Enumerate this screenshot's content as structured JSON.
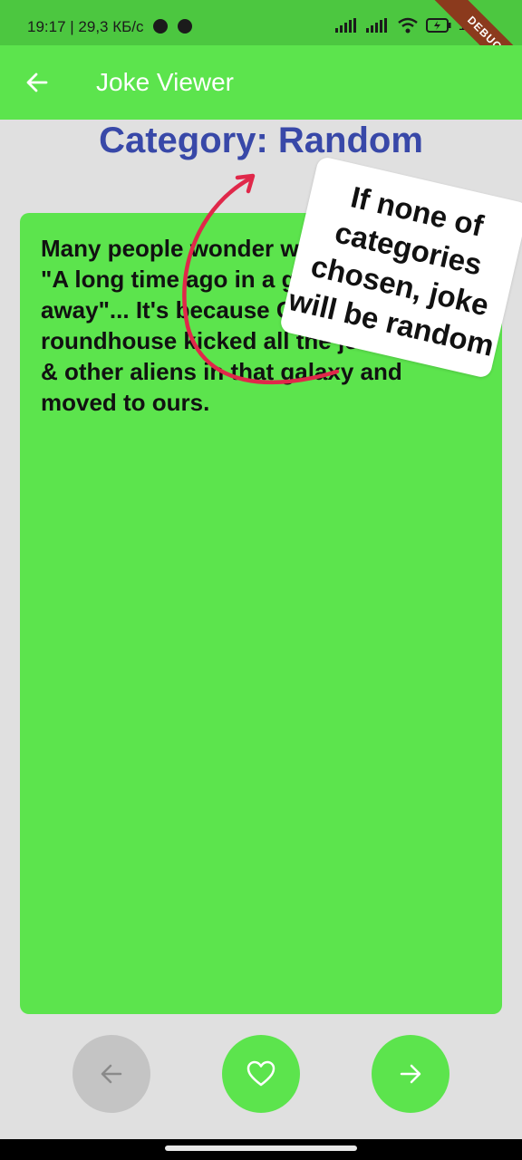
{
  "status_bar": {
    "time_speed": "19:17 | 29,3 КБ/с",
    "battery": "100"
  },
  "debug_banner": "DEBUG",
  "app_bar": {
    "title": "Joke Viewer",
    "back_icon": "arrow-back-icon"
  },
  "category": {
    "title": "Category: Random"
  },
  "joke": {
    "text": "Many people wonder why begins with \"A long time ago in a galaxy far, far away\"... It's because Chuck Norris roundhouse kicked all the jedi, clones & other aliens in that galaxy and moved to ours."
  },
  "annotation": {
    "note": "If none of categories chosen, joke will be random",
    "arrow_color": "#e0284a"
  },
  "buttons": {
    "previous": {
      "icon": "arrow-left-icon",
      "state": "disabled"
    },
    "favorite": {
      "icon": "heart-outline-icon",
      "state": "enabled"
    },
    "next": {
      "icon": "arrow-right-icon",
      "state": "enabled"
    }
  },
  "colors": {
    "app_bar": "#5ce44d",
    "status_bar": "#4cc740",
    "title": "#3848a8",
    "background": "#e0e0e0",
    "card": "#5ce44d"
  }
}
